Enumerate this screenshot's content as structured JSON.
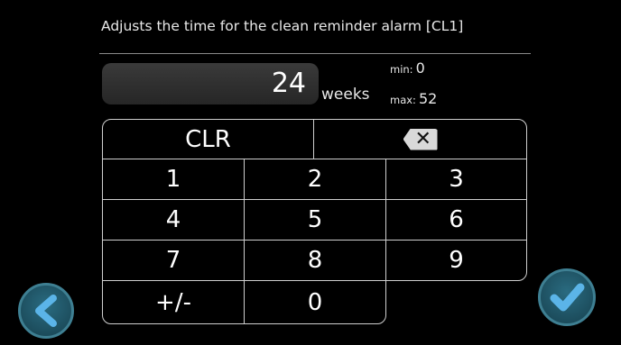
{
  "description": "Adjusts the time for the clean reminder alarm [CL1]",
  "value": "24",
  "unit": "weeks",
  "min_label": "min:",
  "min_value": "0",
  "max_label": "max:",
  "max_value": "52",
  "keypad": {
    "clr": "CLR",
    "backspace_icon": "backspace-icon",
    "k1": "1",
    "k2": "2",
    "k3": "3",
    "k4": "4",
    "k5": "5",
    "k6": "6",
    "k7": "7",
    "k8": "8",
    "k9": "9",
    "sign": "+/-",
    "k0": "0"
  },
  "nav": {
    "back_icon": "chevron-left-icon",
    "confirm_icon": "checkmark-icon"
  },
  "colors": {
    "accent_button": "#1f5566",
    "icon": "#5bb4e8"
  }
}
